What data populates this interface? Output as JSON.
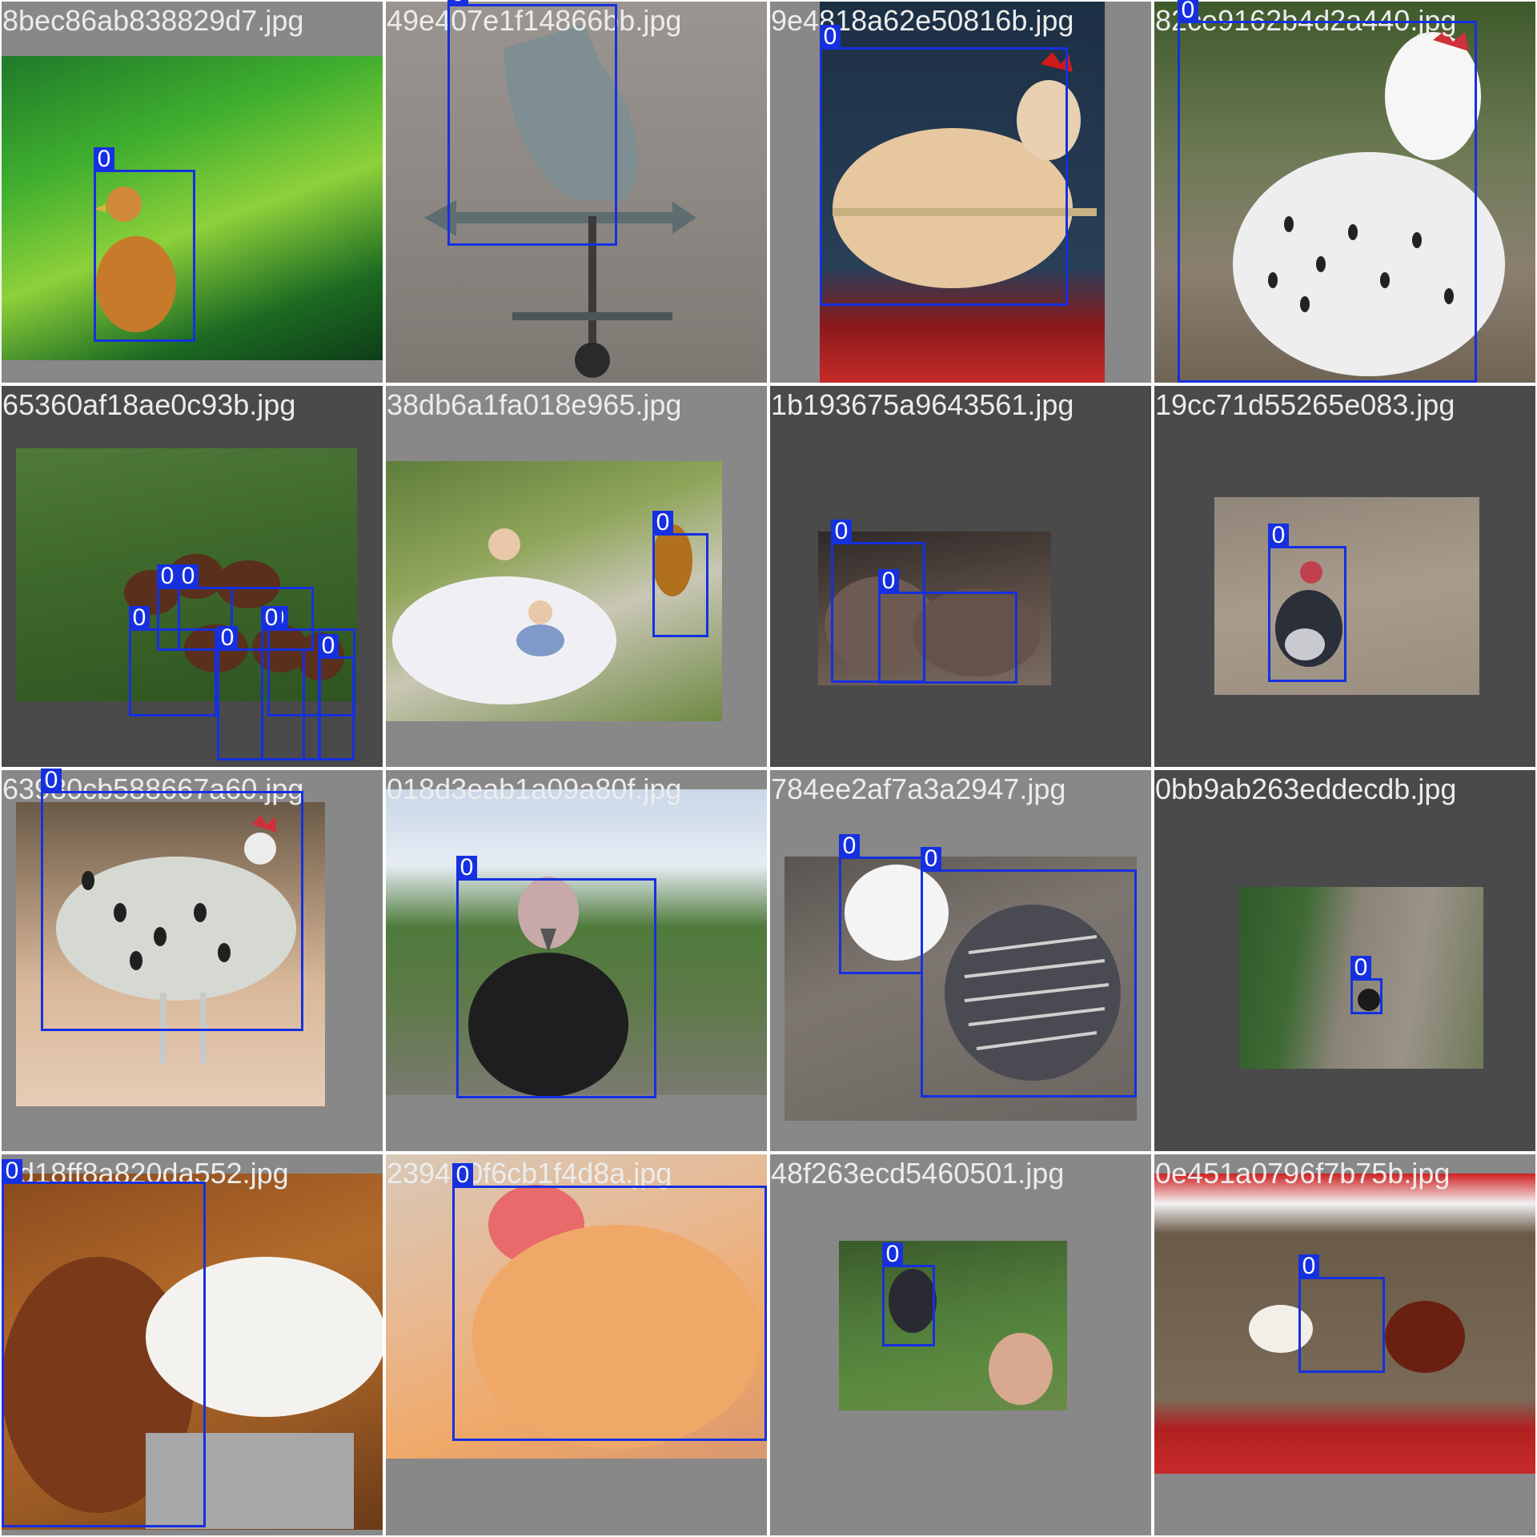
{
  "colors": {
    "box": "#1630e0",
    "label_bg": "#1630e0",
    "label_text": "#ffffff",
    "filename_text": "#ececec",
    "tile_bg": "#888888",
    "tile_bg_dark": "#4a4a4a"
  },
  "tiles": [
    {
      "filename": "8bec86ab838829d7.jpg",
      "labels": [
        "0"
      ]
    },
    {
      "filename": "49e407e1f14866bb.jpg",
      "labels": [
        "0"
      ]
    },
    {
      "filename": "9e4818a62e50816b.jpg",
      "labels": [
        "0"
      ]
    },
    {
      "filename": "82ce9162b4d2a440.jpg",
      "labels": [
        "0"
      ]
    },
    {
      "filename": "65360af18ae0c93b.jpg",
      "labels": [
        "0",
        "0",
        "0",
        "0",
        "0",
        "0",
        "0"
      ]
    },
    {
      "filename": "38db6a1fa018e965.jpg",
      "labels": [
        "0"
      ]
    },
    {
      "filename": "1b193675a9643561.jpg",
      "labels": [
        "0",
        "0"
      ]
    },
    {
      "filename": "19cc71d55265e083.jpg",
      "labels": [
        "0"
      ]
    },
    {
      "filename": "63980cb588667a60.jpg",
      "labels": [
        "0"
      ]
    },
    {
      "filename": "018d3eab1a09a80f.jpg",
      "labels": [
        "0"
      ]
    },
    {
      "filename": "784ee2af7a3a2947.jpg",
      "labels": [
        "0",
        "0"
      ]
    },
    {
      "filename": "0bb9ab263eddecdb.jpg",
      "labels": [
        "0"
      ]
    },
    {
      "filename": "0d18ff8a820da552.jpg",
      "labels": [
        "0"
      ]
    },
    {
      "filename": "239400f6cb1f4d8a.jpg",
      "labels": [
        "0"
      ]
    },
    {
      "filename": "48f263ecd5460501.jpg",
      "labels": [
        "0"
      ]
    },
    {
      "filename": "0e451a0796f7b75b.jpg",
      "labels": [
        "0"
      ]
    }
  ]
}
